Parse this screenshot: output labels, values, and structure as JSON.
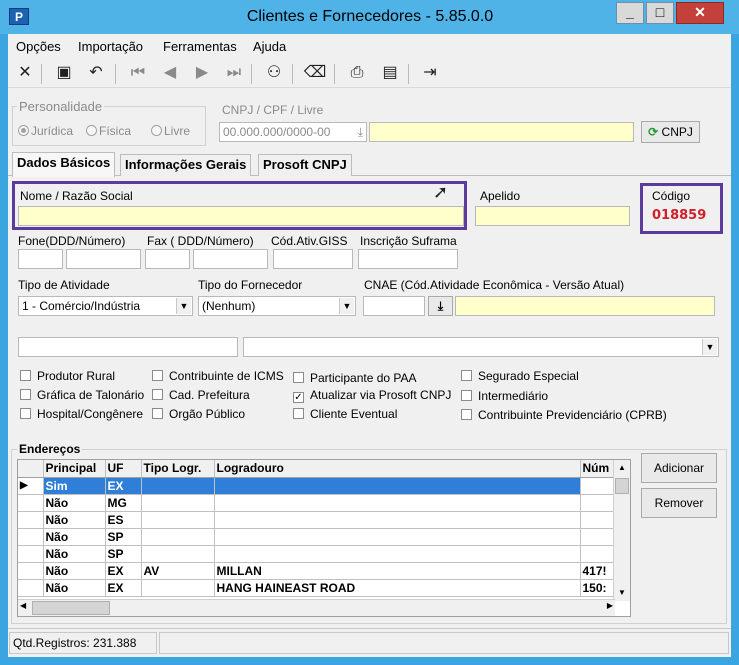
{
  "window": {
    "title": "Clientes e Fornecedores - 5.85.0.0",
    "app_icon_letter": "P",
    "minimize": "_",
    "maximize": "□",
    "close": "✕"
  },
  "menu": [
    "Opções",
    "Importação",
    "Ferramentas",
    "Ajuda"
  ],
  "toolbar": {
    "icons": [
      "close-x-icon",
      "save-icon",
      "undo-icon",
      "first-record-icon",
      "previous-record-icon",
      "next-record-icon",
      "last-record-icon",
      "binoculars-icon",
      "eraser-icon",
      "print-icon",
      "print-preview-icon",
      "exit-door-icon"
    ]
  },
  "personalidade": {
    "title": "Personalidade",
    "options": [
      "Jurídica",
      "Física",
      "Livre"
    ],
    "selected": "Jurídica"
  },
  "cnpj": {
    "label": "CNPJ / CPF / Livre",
    "value": "00.000.000/0000-00",
    "button": "CNPJ"
  },
  "tabs": [
    "Dados Básicos",
    "Informações Gerais",
    "Prosoft CNPJ"
  ],
  "fields": {
    "nome_label": "Nome / Razão Social",
    "apelido_label": "Apelido",
    "codigo_label": "Código",
    "codigo_value": "018859",
    "fone_label": "Fone(DDD/Número)",
    "fax_label": "Fax ( DDD/Número)",
    "cod_ativ_label": "Cód.Ativ.GISS",
    "suframa_label": "Inscrição Suframa",
    "tipo_atividade_label": "Tipo de Atividade",
    "tipo_atividade_value": "1 - Comércio/Indústria",
    "tipo_fornecedor_label": "Tipo do Fornecedor",
    "tipo_fornecedor_value": "(Nenhum)",
    "cnae_label": "CNAE (Cód.Atividade Econômica - Versão Atual)"
  },
  "checkboxes": {
    "col1": [
      "Produtor Rural",
      "Gráfica de Talonário",
      "Hospital/Congênere"
    ],
    "col2": [
      "Contribuinte de ICMS",
      "Cad. Prefeitura",
      "Orgão Público"
    ],
    "col3": [
      "Participante do PAA",
      "Atualizar via Prosoft CNPJ",
      "Cliente Eventual"
    ],
    "col4": [
      "Segurado Especial",
      "Intermediário",
      "Contribuinte Previdenciário (CPRB)"
    ],
    "checked": "Atualizar via Prosoft CNPJ"
  },
  "enderecos": {
    "title": "Endereços",
    "headers": [
      "Principal",
      "UF",
      "Tipo Logr.",
      "Logradouro",
      "Núm"
    ],
    "rows": [
      [
        "Sim",
        "EX",
        "",
        "",
        ""
      ],
      [
        "Não",
        "MG",
        "",
        "",
        ""
      ],
      [
        "Não",
        "ES",
        "",
        "",
        ""
      ],
      [
        "Não",
        "SP",
        "",
        "",
        ""
      ],
      [
        "Não",
        "SP",
        "",
        "",
        ""
      ],
      [
        "Não",
        "EX",
        "AV",
        "MILLAN",
        "417!"
      ],
      [
        "Não",
        "EX",
        "",
        "HANG HAINEAST ROAD",
        "150:"
      ]
    ],
    "add_button": "Adicionar",
    "remove_button": "Remover"
  },
  "status": {
    "registros": "Qtd.Registros: 231.388"
  },
  "colors": {
    "titlebar": "#4fb3e8",
    "selection": "#2f7fd8",
    "highlight_box": "#5b3b9c",
    "codigo_text": "#d0202a",
    "input_yellow": "#ffffcc"
  }
}
